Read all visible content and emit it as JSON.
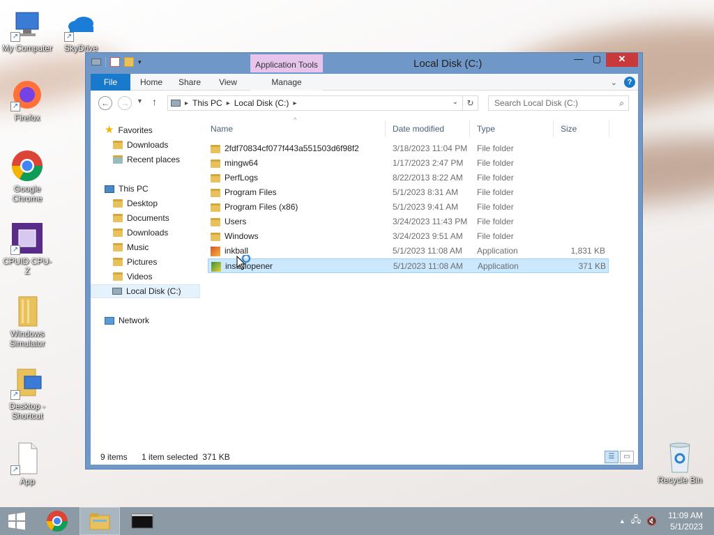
{
  "desktop": {
    "icons": [
      {
        "label": "My Computer"
      },
      {
        "label": "SkyDrive"
      },
      {
        "label": "Firefox"
      },
      {
        "label": "Google Chrome"
      },
      {
        "label": "CPUID CPU-Z"
      },
      {
        "label": "Windows Simulator"
      },
      {
        "label": "Desktop - Shortcut"
      },
      {
        "label": "App"
      },
      {
        "label": "Recycle Bin"
      }
    ]
  },
  "window": {
    "title": "Local Disk (C:)",
    "context_tab": "Application Tools",
    "ribbon_tabs": [
      "File",
      "Home",
      "Share",
      "View",
      "Manage"
    ],
    "address": [
      "This PC",
      "Local Disk (C:)"
    ],
    "search_placeholder": "Search Local Disk (C:)"
  },
  "navpane": {
    "favorites": "Favorites",
    "fav_items": [
      "Downloads",
      "Recent places"
    ],
    "this_pc": "This PC",
    "pc_items": [
      "Desktop",
      "Documents",
      "Downloads",
      "Music",
      "Pictures",
      "Videos",
      "Local Disk (C:)"
    ],
    "network": "Network"
  },
  "filelist": {
    "columns": [
      "Name",
      "Date modified",
      "Type",
      "Size"
    ],
    "rows": [
      {
        "name": "2fdf70834cf077f443a551503d6f98f2",
        "date": "3/18/2023 11:04 PM",
        "type": "File folder",
        "size": "",
        "icon": "folder"
      },
      {
        "name": "mingw64",
        "date": "1/17/2023 2:47 PM",
        "type": "File folder",
        "size": "",
        "icon": "folder"
      },
      {
        "name": "PerfLogs",
        "date": "8/22/2013 8:22 AM",
        "type": "File folder",
        "size": "",
        "icon": "folder"
      },
      {
        "name": "Program Files",
        "date": "5/1/2023 8:31 AM",
        "type": "File folder",
        "size": "",
        "icon": "folder"
      },
      {
        "name": "Program Files (x86)",
        "date": "5/1/2023 9:41 AM",
        "type": "File folder",
        "size": "",
        "icon": "folder"
      },
      {
        "name": "Users",
        "date": "3/24/2023 11:43 PM",
        "type": "File folder",
        "size": "",
        "icon": "folder"
      },
      {
        "name": "Windows",
        "date": "3/24/2023 9:51 AM",
        "type": "File folder",
        "size": "",
        "icon": "folder"
      },
      {
        "name": "inkball",
        "date": "5/1/2023 11:08 AM",
        "type": "Application",
        "size": "1,831 KB",
        "icon": "app"
      },
      {
        "name": "installopener",
        "date": "5/1/2023 11:08 AM",
        "type": "Application",
        "size": "371 KB",
        "icon": "app"
      }
    ]
  },
  "status": {
    "count": "9 items",
    "selection": "1 item selected  371 KB"
  },
  "taskbar": {
    "time": "11:09 AM",
    "date": "5/1/2023"
  }
}
